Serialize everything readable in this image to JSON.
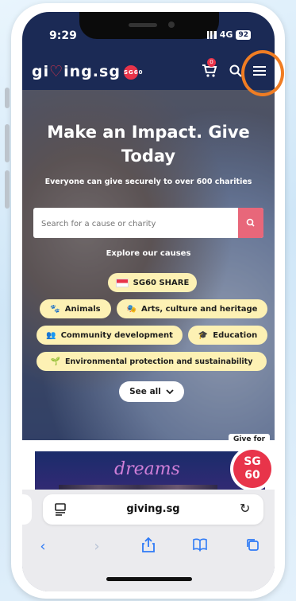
{
  "status": {
    "time": "9:29",
    "network": "4G",
    "battery": "92"
  },
  "nav": {
    "logo_pre": "gi",
    "logo_heart": "♡",
    "logo_post": "ing.sg",
    "logo_badge": "SG60",
    "cart_count": "0"
  },
  "hero": {
    "title_line1": "Make an Impact. Give",
    "title_line2": "Today",
    "subtitle": "Everyone can give securely to over 600 charities",
    "search_placeholder": "Search for a cause or charity",
    "explore_label": "Explore our causes",
    "chips": [
      {
        "label": "SG60 SHARE",
        "icon": "flag-icon"
      },
      {
        "label": "Animals",
        "icon": "paw-icon"
      },
      {
        "label": "Arts, culture and heritage",
        "icon": "theatre-masks-icon"
      },
      {
        "label": "Community development",
        "icon": "people-icon"
      },
      {
        "label": "Education",
        "icon": "graduation-cap-icon"
      },
      {
        "label": "Environmental protection and sustainability",
        "icon": "sprout-icon"
      }
    ],
    "see_all": "See all"
  },
  "banner": {
    "word": "dreams",
    "give_for": "Give for",
    "sg": "SG",
    "sixty": "60"
  },
  "browser": {
    "url": "giving.sg"
  },
  "colors": {
    "navy": "#1b2a55",
    "accent_red": "#e8344a",
    "chip_yellow": "#fdf1b4",
    "highlight_orange": "#f07d23",
    "safari_blue": "#2f7bf6"
  }
}
